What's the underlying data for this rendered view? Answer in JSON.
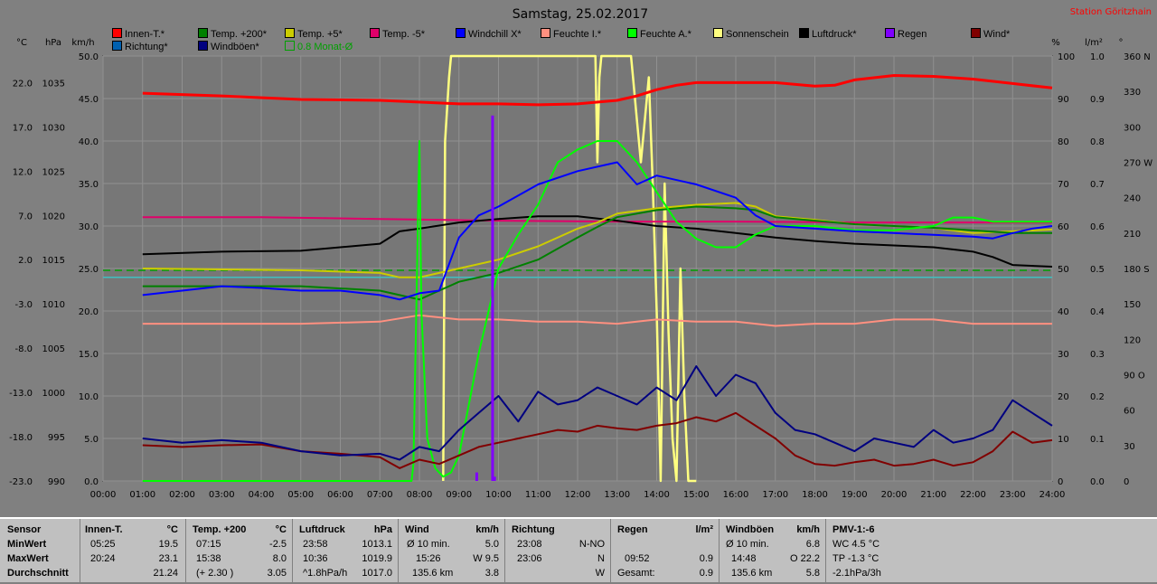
{
  "title": "Samstag, 25.02.2017",
  "station": "Station Göritzhain",
  "axis_units": {
    "celsius": "°C",
    "hpa": "hPa",
    "kmh": "km/h",
    "percent": "%",
    "lm2": "l/m²",
    "deg": "°"
  },
  "legend": [
    {
      "label": "Innen-T.*",
      "color": "#ff0000"
    },
    {
      "label": "Temp. +200*",
      "color": "#008000"
    },
    {
      "label": "Temp. +5*",
      "color": "#cccc00"
    },
    {
      "label": "Temp. -5*",
      "color": "#e0006a"
    },
    {
      "label": "Windchill X*",
      "color": "#0000ff"
    },
    {
      "label": "Feuchte I.*",
      "color": "#ff9080"
    },
    {
      "label": "Feuchte A.*",
      "color": "#00ff00"
    },
    {
      "label": "Sonnenschein",
      "color": "#ffff80"
    },
    {
      "label": "Luftdruck*",
      "color": "#000000"
    },
    {
      "label": "Regen",
      "color": "#8000ff"
    },
    {
      "label": "Wind*",
      "color": "#800000"
    },
    {
      "label": "Richtung*",
      "color": "#0060b0"
    },
    {
      "label": "Windböen*",
      "color": "#000080"
    },
    {
      "label": "0.8 Monat-Ø",
      "color": "#00a000"
    }
  ],
  "chart_data": {
    "type": "line",
    "title": "Samstag, 25.02.2017",
    "x_ticks": [
      "00:00",
      "01:00",
      "02:00",
      "03:00",
      "04:00",
      "05:00",
      "06:00",
      "07:00",
      "08:00",
      "09:00",
      "10:00",
      "11:00",
      "12:00",
      "13:00",
      "14:00",
      "15:00",
      "16:00",
      "17:00",
      "18:00",
      "19:00",
      "20:00",
      "21:00",
      "22:00",
      "23:00",
      "24:00"
    ],
    "axes": {
      "temp_c": {
        "label": "°C",
        "ticks": [
          "22.0",
          "17.0",
          "12.0",
          "7.0",
          "2.0",
          "-3.0",
          "-8.0",
          "-13.0",
          "-18.0",
          "-23.0"
        ],
        "range": [
          -23,
          25
        ]
      },
      "pressure_hpa": {
        "label": "hPa",
        "ticks": [
          "1035",
          "1030",
          "1025",
          "1020",
          "1015",
          "1010",
          "1005",
          "1000",
          "995",
          "990"
        ],
        "range": [
          990,
          1038
        ]
      },
      "wind_kmh": {
        "label": "km/h",
        "ticks": [
          "50.0",
          "45.0",
          "40.0",
          "35.0",
          "30.0",
          "25.0",
          "20.0",
          "15.0",
          "10.0",
          "5.0",
          "0.0"
        ],
        "range": [
          0,
          50
        ]
      },
      "humidity_pct": {
        "label": "%",
        "ticks": [
          "100",
          "90",
          "80",
          "70",
          "60",
          "50",
          "40",
          "30",
          "20",
          "10",
          "0"
        ],
        "range": [
          0,
          100
        ]
      },
      "rain_lm2": {
        "label": "l/m²",
        "ticks": [
          "1.0",
          "0.9",
          "0.8",
          "0.7",
          "0.6",
          "0.5",
          "0.4",
          "0.3",
          "0.2",
          "0.1",
          "0.0"
        ],
        "range": [
          0,
          1
        ]
      },
      "direction_deg": {
        "label": "°",
        "ticks": [
          "360 N",
          "330",
          "300",
          "270 W",
          "240",
          "210",
          "180 S",
          "150",
          "120",
          "90 O",
          "60",
          "30",
          "0"
        ],
        "range": [
          0,
          360
        ]
      }
    },
    "series": [
      {
        "name": "Innen-T.*",
        "axis": "temp_c",
        "color": "#ff0000",
        "x": [
          1,
          3,
          5,
          7,
          9,
          10,
          11,
          12,
          13,
          13.5,
          14,
          14.5,
          15,
          16,
          17,
          18,
          18.5,
          19,
          20,
          21,
          22,
          23,
          24
        ],
        "y": [
          20.8,
          20.5,
          20.1,
          20.0,
          19.6,
          19.6,
          19.5,
          19.6,
          20.0,
          20.5,
          21.2,
          21.7,
          22.0,
          22.0,
          22.0,
          21.6,
          21.7,
          22.3,
          22.8,
          22.7,
          22.4,
          21.9,
          21.4
        ]
      },
      {
        "name": "Temp. +200*",
        "axis": "temp_c",
        "color": "#008000",
        "x": [
          1,
          3,
          5,
          7,
          7.5,
          8,
          8.5,
          9,
          10,
          11,
          12,
          12.5,
          13,
          14,
          15,
          16,
          16.5,
          17,
          18,
          19,
          20,
          21,
          22,
          23,
          24
        ],
        "y": [
          -1.0,
          -1.0,
          -1.0,
          -1.5,
          -2.0,
          -2.5,
          -1.5,
          -0.5,
          0.5,
          2.0,
          4.5,
          5.7,
          6.8,
          7.6,
          8.0,
          7.8,
          7.6,
          6.8,
          6.4,
          6.0,
          5.8,
          5.6,
          5.3,
          5.0,
          5.0
        ]
      },
      {
        "name": "Temp. +5*",
        "axis": "temp_c",
        "color": "#cccc00",
        "x": [
          1,
          3,
          5,
          7,
          7.5,
          8,
          8.5,
          9,
          10,
          11,
          12,
          12.5,
          13,
          14,
          15,
          16,
          16.5,
          17,
          18,
          19,
          20,
          21,
          22,
          23,
          24
        ],
        "y": [
          1.0,
          0.9,
          0.8,
          0.5,
          0.0,
          0.0,
          0.5,
          1.0,
          2.0,
          3.5,
          5.5,
          6.2,
          7.2,
          7.8,
          8.2,
          8.4,
          8.0,
          6.9,
          6.5,
          6.0,
          5.8,
          5.6,
          5.0,
          5.2,
          5.4
        ]
      },
      {
        "name": "Temp. -5*",
        "axis": "temp_c",
        "color": "#e0006a",
        "x": [
          1,
          4,
          7,
          10,
          13,
          16,
          19,
          22,
          24
        ],
        "y": [
          6.8,
          6.8,
          6.6,
          6.4,
          6.3,
          6.3,
          6.2,
          6.2,
          6.2
        ]
      },
      {
        "name": "Windchill X*",
        "axis": "temp_c",
        "color": "#0000ff",
        "x": [
          1,
          2,
          3,
          4,
          5,
          6,
          7,
          7.5,
          8,
          8.5,
          9,
          9.5,
          10,
          11,
          12,
          13,
          13.5,
          14,
          15,
          16,
          16.5,
          17,
          18,
          19,
          20,
          21,
          22,
          22.5,
          23,
          23.5,
          24
        ],
        "y": [
          -2.0,
          -1.5,
          -1.0,
          -1.2,
          -1.5,
          -1.5,
          -2.0,
          -2.5,
          -1.8,
          -1.5,
          4.5,
          7.0,
          8.0,
          10.5,
          12.0,
          13.0,
          10.5,
          11.5,
          10.5,
          9.0,
          7.0,
          5.8,
          5.5,
          5.2,
          5.0,
          4.8,
          4.6,
          4.4,
          5.0,
          5.5,
          5.8
        ]
      },
      {
        "name": "Feuchte I.*",
        "axis": "humidity_pct",
        "color": "#ff9080",
        "x": [
          1,
          3,
          5,
          7,
          8,
          9,
          10,
          11,
          12,
          13,
          14,
          15,
          16,
          17,
          18,
          19,
          20,
          21,
          22,
          23,
          24
        ],
        "y": [
          37,
          37,
          37,
          37.5,
          39,
          38,
          38,
          37.5,
          37.5,
          37,
          38,
          37.5,
          37.5,
          36.5,
          37,
          37,
          38,
          38,
          37,
          37,
          37
        ]
      },
      {
        "name": "Feuchte A.*",
        "axis": "humidity_pct",
        "color": "#00ff00",
        "x": [
          1,
          7.8,
          7.85,
          8.0,
          8.05,
          8.2,
          8.4,
          8.6,
          8.8,
          9,
          9.5,
          10,
          10.5,
          11,
          11.5,
          12,
          12.5,
          13,
          13.5,
          14,
          14.5,
          15,
          15.5,
          16,
          16.5,
          17,
          18,
          19,
          20,
          21,
          21.5,
          22,
          22.5,
          23,
          24
        ],
        "y": [
          0,
          0,
          4,
          80,
          40,
          10,
          3,
          1,
          2,
          6,
          30,
          50,
          58,
          65,
          75,
          78,
          80,
          80,
          75,
          68,
          61,
          57,
          55,
          55,
          58,
          60,
          60,
          59,
          59,
          60,
          62,
          62,
          61,
          61,
          61
        ]
      },
      {
        "name": "Sonnenschein",
        "axis": "humidity_pct",
        "color": "#ffff80",
        "x": [
          8.6,
          8.65,
          8.75,
          8.8,
          12.45,
          12.5,
          12.55,
          12.6,
          13.35,
          13.4,
          13.5,
          13.6,
          13.8,
          13.9,
          14.0,
          14.1,
          14.2,
          14.3,
          14.4,
          14.5,
          14.6,
          14.7,
          14.8,
          14.9,
          15.0
        ],
        "y": [
          0,
          80,
          95,
          100,
          100,
          75,
          95,
          100,
          100,
          95,
          85,
          75,
          95,
          70,
          40,
          0,
          70,
          35,
          10,
          0,
          50,
          20,
          0,
          0,
          0
        ]
      },
      {
        "name": "Luftdruck*",
        "axis": "pressure_hpa",
        "color": "#000000",
        "x": [
          1,
          3,
          5,
          7,
          7.5,
          8,
          9,
          10,
          11,
          12,
          13,
          14,
          15,
          16,
          17,
          18,
          19,
          20,
          21,
          22,
          22.5,
          23,
          24
        ],
        "y": [
          1015.6,
          1015.9,
          1016.0,
          1016.8,
          1018.2,
          1018.5,
          1019.2,
          1019.6,
          1019.9,
          1019.9,
          1019.4,
          1018.8,
          1018.5,
          1018.0,
          1017.5,
          1017.1,
          1016.8,
          1016.6,
          1016.4,
          1015.9,
          1015.3,
          1014.4,
          1014.2
        ]
      },
      {
        "name": "Regen",
        "axis": "rain_lm2",
        "color": "#8000ff",
        "bars": [
          {
            "x": 9.85,
            "y": 0.86
          },
          {
            "x": 9.45,
            "y": 0.02
          },
          {
            "x": 9.9,
            "y": 0.01
          }
        ]
      },
      {
        "name": "Wind*",
        "axis": "wind_kmh",
        "color": "#800000",
        "x": [
          1,
          2,
          3,
          4,
          5,
          6,
          7,
          7.5,
          8,
          8.5,
          9,
          9.5,
          10,
          10.5,
          11,
          11.5,
          12,
          12.5,
          13,
          13.5,
          14,
          14.5,
          15,
          15.5,
          16,
          16.5,
          17,
          17.5,
          18,
          18.5,
          19,
          19.5,
          20,
          20.5,
          21,
          21.5,
          22,
          22.5,
          23,
          23.5,
          24
        ],
        "y": [
          4.2,
          4.0,
          4.2,
          4.3,
          3.5,
          3.2,
          2.8,
          1.5,
          2.5,
          2.0,
          3.0,
          4.0,
          4.5,
          5.0,
          5.5,
          6.0,
          5.8,
          6.5,
          6.2,
          6.0,
          6.5,
          6.8,
          7.5,
          7.0,
          8.0,
          6.5,
          5.0,
          3.0,
          2.0,
          1.8,
          2.2,
          2.5,
          1.8,
          2.0,
          2.5,
          1.8,
          2.2,
          3.5,
          5.8,
          4.5,
          4.8
        ]
      },
      {
        "name": "Windböen*",
        "axis": "wind_kmh",
        "color": "#000080",
        "x": [
          1,
          2,
          3,
          4,
          5,
          6,
          7,
          7.5,
          8,
          8.5,
          9,
          9.5,
          10,
          10.5,
          11,
          11.5,
          12,
          12.5,
          13,
          13.5,
          14,
          14.5,
          15,
          15.5,
          16,
          16.5,
          17,
          17.5,
          18,
          18.5,
          19,
          19.5,
          20,
          20.5,
          21,
          21.5,
          22,
          22.5,
          23,
          23.5,
          24
        ],
        "y": [
          5.0,
          4.5,
          4.8,
          4.5,
          3.5,
          3.0,
          3.2,
          2.5,
          4.0,
          3.5,
          6.0,
          8.0,
          10.0,
          7.0,
          10.5,
          9.0,
          9.5,
          11.0,
          10.0,
          9.0,
          11.0,
          9.5,
          13.5,
          10.0,
          12.5,
          11.5,
          8.0,
          6.0,
          5.5,
          4.5,
          3.5,
          5.0,
          4.5,
          4.0,
          6.0,
          4.5,
          5.0,
          6.0,
          9.5,
          8.0,
          6.5
        ]
      }
    ],
    "reference_lines": [
      {
        "name": "0.8 Monat-Ø",
        "axis": "temp_c",
        "value": 0.8,
        "color": "#00a000",
        "dashed": true
      },
      {
        "name": "0 °C",
        "axis": "temp_c",
        "value": 0.0,
        "color": "#40c0c0",
        "dashed": false
      }
    ]
  },
  "stats": {
    "labels": {
      "sensor": "Sensor",
      "min": "MinWert",
      "max": "MaxWert",
      "avg": "Durchschnitt"
    },
    "innen": {
      "title": "Innen-T.",
      "unit": "°C",
      "min_time": "05:25",
      "min_val": "19.5",
      "max_time": "20:24",
      "max_val": "23.1",
      "avg_val": "21.24"
    },
    "temp200": {
      "title": "Temp. +200",
      "unit": "°C",
      "min_time": "07:15",
      "min_val": "-2.5",
      "max_time": "15:38",
      "max_val": "8.0",
      "avg_note": "(+ 2.30 )",
      "avg_val": "3.05"
    },
    "luftdruck": {
      "title": "Luftdruck",
      "unit": "hPa",
      "min_time": "23:58",
      "min_val": "1013.1",
      "max_time": "10:36",
      "max_val": "1019.9",
      "avg_note": "^1.8hPa/h",
      "avg_val": "1017.0"
    },
    "wind": {
      "title": "Wind",
      "unit": "km/h",
      "row1_label": "Ø 10 min.",
      "row1_val": "5.0",
      "row2_label": "15:26",
      "row2_val": "W 9.5",
      "row3_label": "135.6 km",
      "row3_val": "3.8"
    },
    "richtung": {
      "title": "Richtung",
      "row1_time": "23:08",
      "row1_val": "N-NO",
      "row2_time": "23:06",
      "row2_val": "N",
      "row3_val": "W"
    },
    "regen": {
      "title": "Regen",
      "unit": "l/m²",
      "row2_time": "09:52",
      "row2_val": "0.9",
      "row3_label": "Gesamt:",
      "row3_val": "0.9"
    },
    "windboeen": {
      "title": "Windböen",
      "unit": "km/h",
      "row1_label": "Ø 10 min.",
      "row1_val": "6.8",
      "row2_label": "14:48",
      "row2_val": "O 22.2",
      "row3_label": "135.6 km",
      "row3_val": "5.8"
    },
    "pmv": {
      "title": "PMV-1:-6",
      "row1": "WC 4.5 °C",
      "row2": "TP -1.3 °C",
      "row3": "-2.1hPa/3h"
    }
  }
}
